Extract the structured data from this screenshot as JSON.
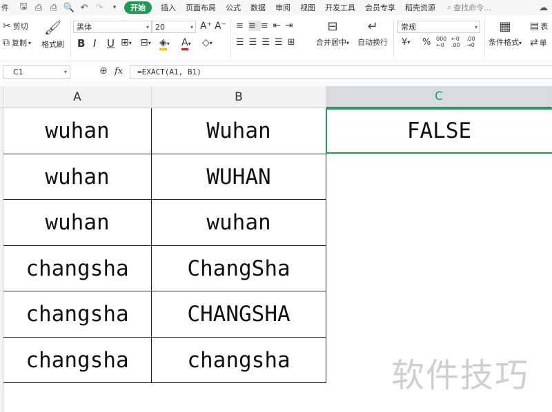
{
  "menubar": {
    "file_label": "件",
    "tabs": [
      "开始",
      "插入",
      "页面布局",
      "公式",
      "数据",
      "审阅",
      "视图",
      "开发工具",
      "会员专享",
      "稻壳资源"
    ],
    "active_tab": "开始",
    "search_placeholder": "查找命令..."
  },
  "ribbon": {
    "cut": "剪切",
    "copy": "复制",
    "format_painter": "格式刷",
    "font_name": "黑体",
    "font_size": "20",
    "merge_center": "合并居中",
    "wrap_text": "自动换行",
    "number_format": "常规",
    "currency_symbol": "¥",
    "percent_symbol": "%",
    "conditional_format": "条件格式",
    "table_label": "表",
    "single_label": "单"
  },
  "formula_bar": {
    "cell_ref": "C1",
    "fx": "fx",
    "formula": "=EXACT(A1, B1)"
  },
  "sheet": {
    "columns": [
      "A",
      "B",
      "C"
    ],
    "selected_column": "C",
    "col_a": [
      "wuhan",
      "wuhan",
      "wuhan",
      "changsha",
      "changsha",
      "changsha"
    ],
    "col_b": [
      "Wuhan",
      "WUHAN",
      "wuhan",
      "ChangSha",
      "CHANGSHA",
      "changsha"
    ],
    "c1": "FALSE"
  },
  "watermark": "软件技巧"
}
